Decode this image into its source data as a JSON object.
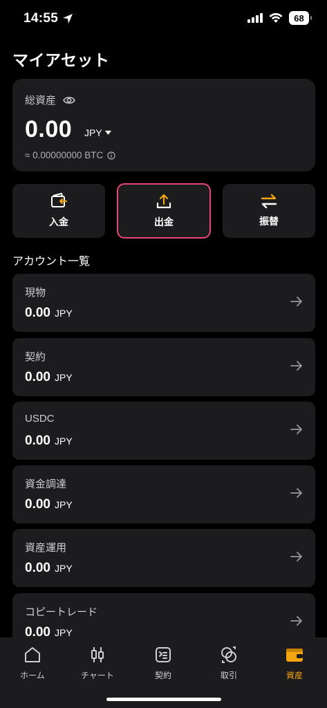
{
  "status_bar": {
    "time": "14:55",
    "battery": "68"
  },
  "page_title": "マイアセット",
  "asset": {
    "label": "総資産",
    "amount": "0.00",
    "currency": "JPY",
    "btc_value": "≈ 0.00000000 BTC"
  },
  "actions": [
    {
      "label": "入金",
      "icon": "deposit-wallet-icon"
    },
    {
      "label": "出金",
      "icon": "withdraw-upload-icon"
    },
    {
      "label": "振替",
      "icon": "transfer-arrows-icon"
    }
  ],
  "accounts_title": "アカウント一覧",
  "accounts": [
    {
      "name": "現物",
      "amount": "0.00",
      "unit": "JPY"
    },
    {
      "name": "契約",
      "amount": "0.00",
      "unit": "JPY"
    },
    {
      "name": "USDC",
      "amount": "0.00",
      "unit": "JPY"
    },
    {
      "name": "資金調達",
      "amount": "0.00",
      "unit": "JPY"
    },
    {
      "name": "資産運用",
      "amount": "0.00",
      "unit": "JPY"
    },
    {
      "name": "コピートレード",
      "amount": "0.00",
      "unit": "JPY"
    }
  ],
  "nav": [
    {
      "label": "ホーム",
      "icon": "home-icon"
    },
    {
      "label": "チャート",
      "icon": "candlestick-icon"
    },
    {
      "label": "契約",
      "icon": "contract-icon"
    },
    {
      "label": "取引",
      "icon": "trade-icon"
    },
    {
      "label": "資産",
      "icon": "wallet-icon"
    }
  ],
  "colors": {
    "accent": "#f3a512",
    "highlight": "#e8457b",
    "card": "#1c1c1f"
  }
}
